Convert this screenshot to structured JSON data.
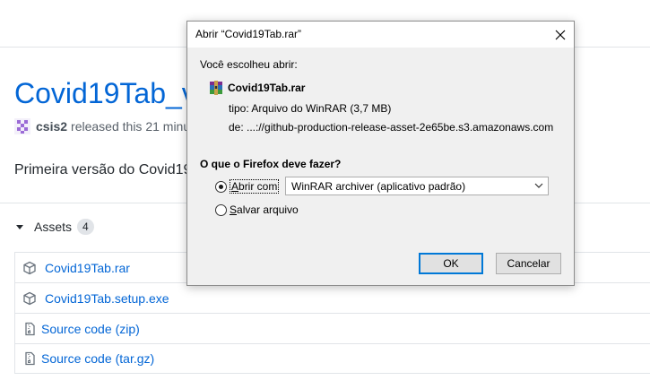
{
  "page": {
    "release_title": "Covid19Tab_v",
    "author": "csis2",
    "released_text": "released this 21 minut",
    "description": "Primeira versão do Covid19",
    "assets_label": "Assets",
    "assets_count": "4",
    "assets": [
      {
        "name": "Covid19Tab.rar",
        "ext": "",
        "icon": "package-icon"
      },
      {
        "name": "Covid19Tab.setup.exe",
        "ext": "",
        "icon": "package-icon"
      },
      {
        "name": "Source code",
        "ext": "(zip)",
        "icon": "file-zip-icon"
      },
      {
        "name": "Source code",
        "ext": "(tar.gz)",
        "icon": "file-zip-icon"
      }
    ]
  },
  "dialog": {
    "title": "Abrir “Covid19Tab.rar”",
    "chosen_text": "Você escolheu abrir:",
    "file_name": "Covid19Tab.rar",
    "file_icon": "winrar-icon",
    "type_line": "tipo:  Arquivo do WinRAR (3,7 MB)",
    "from_line": "de:  ...://github-production-release-asset-2e65be.s3.amazonaws.com",
    "question": "O que o Firefox deve fazer?",
    "open_with_prefix": "A",
    "open_with_rest": "brir com",
    "open_with_checked": true,
    "app_select_value": "WinRAR archiver (aplicativo padrão)",
    "save_prefix": "S",
    "save_rest": "alvar arquivo",
    "save_checked": false,
    "ok_label": "OK",
    "cancel_label": "Cancelar",
    "accent_color": "#0078d7"
  }
}
